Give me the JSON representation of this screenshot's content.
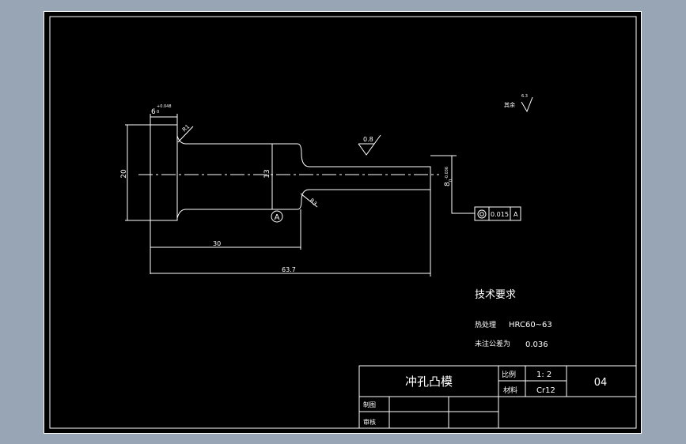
{
  "drawing": {
    "dim_top_width": "6",
    "dim_top_tol_upper": "+0.048",
    "dim_top_tol_lower": "0",
    "radius_1": "R1",
    "radius_2": "R3",
    "dia_head": "20",
    "dia_body": "13",
    "dia_tip_nominal": "8",
    "dia_tip_tol_upper": "0",
    "dia_tip_tol_lower": "-0.036",
    "roughness_tip": "0.8",
    "datum_label": "A",
    "len_30": "30",
    "len_total": "63.7",
    "other_roughness_label": "其余",
    "other_roughness_value": "6.3",
    "tolerance_value": "0.015",
    "tolerance_datum": "A"
  },
  "notes": {
    "title": "技术要求",
    "heat_label": "热处理",
    "heat_value": "HRC60~63",
    "tol_label": "未注公差为",
    "tol_value": "0.036"
  },
  "title_block": {
    "part_name": "冲孔凸模",
    "scale_label": "比例",
    "scale_value": "1: 2",
    "material_label": "材料",
    "material_value": "Cr12",
    "drawing_no": "04",
    "drawn_by": "制图",
    "checked_by": "审核"
  }
}
